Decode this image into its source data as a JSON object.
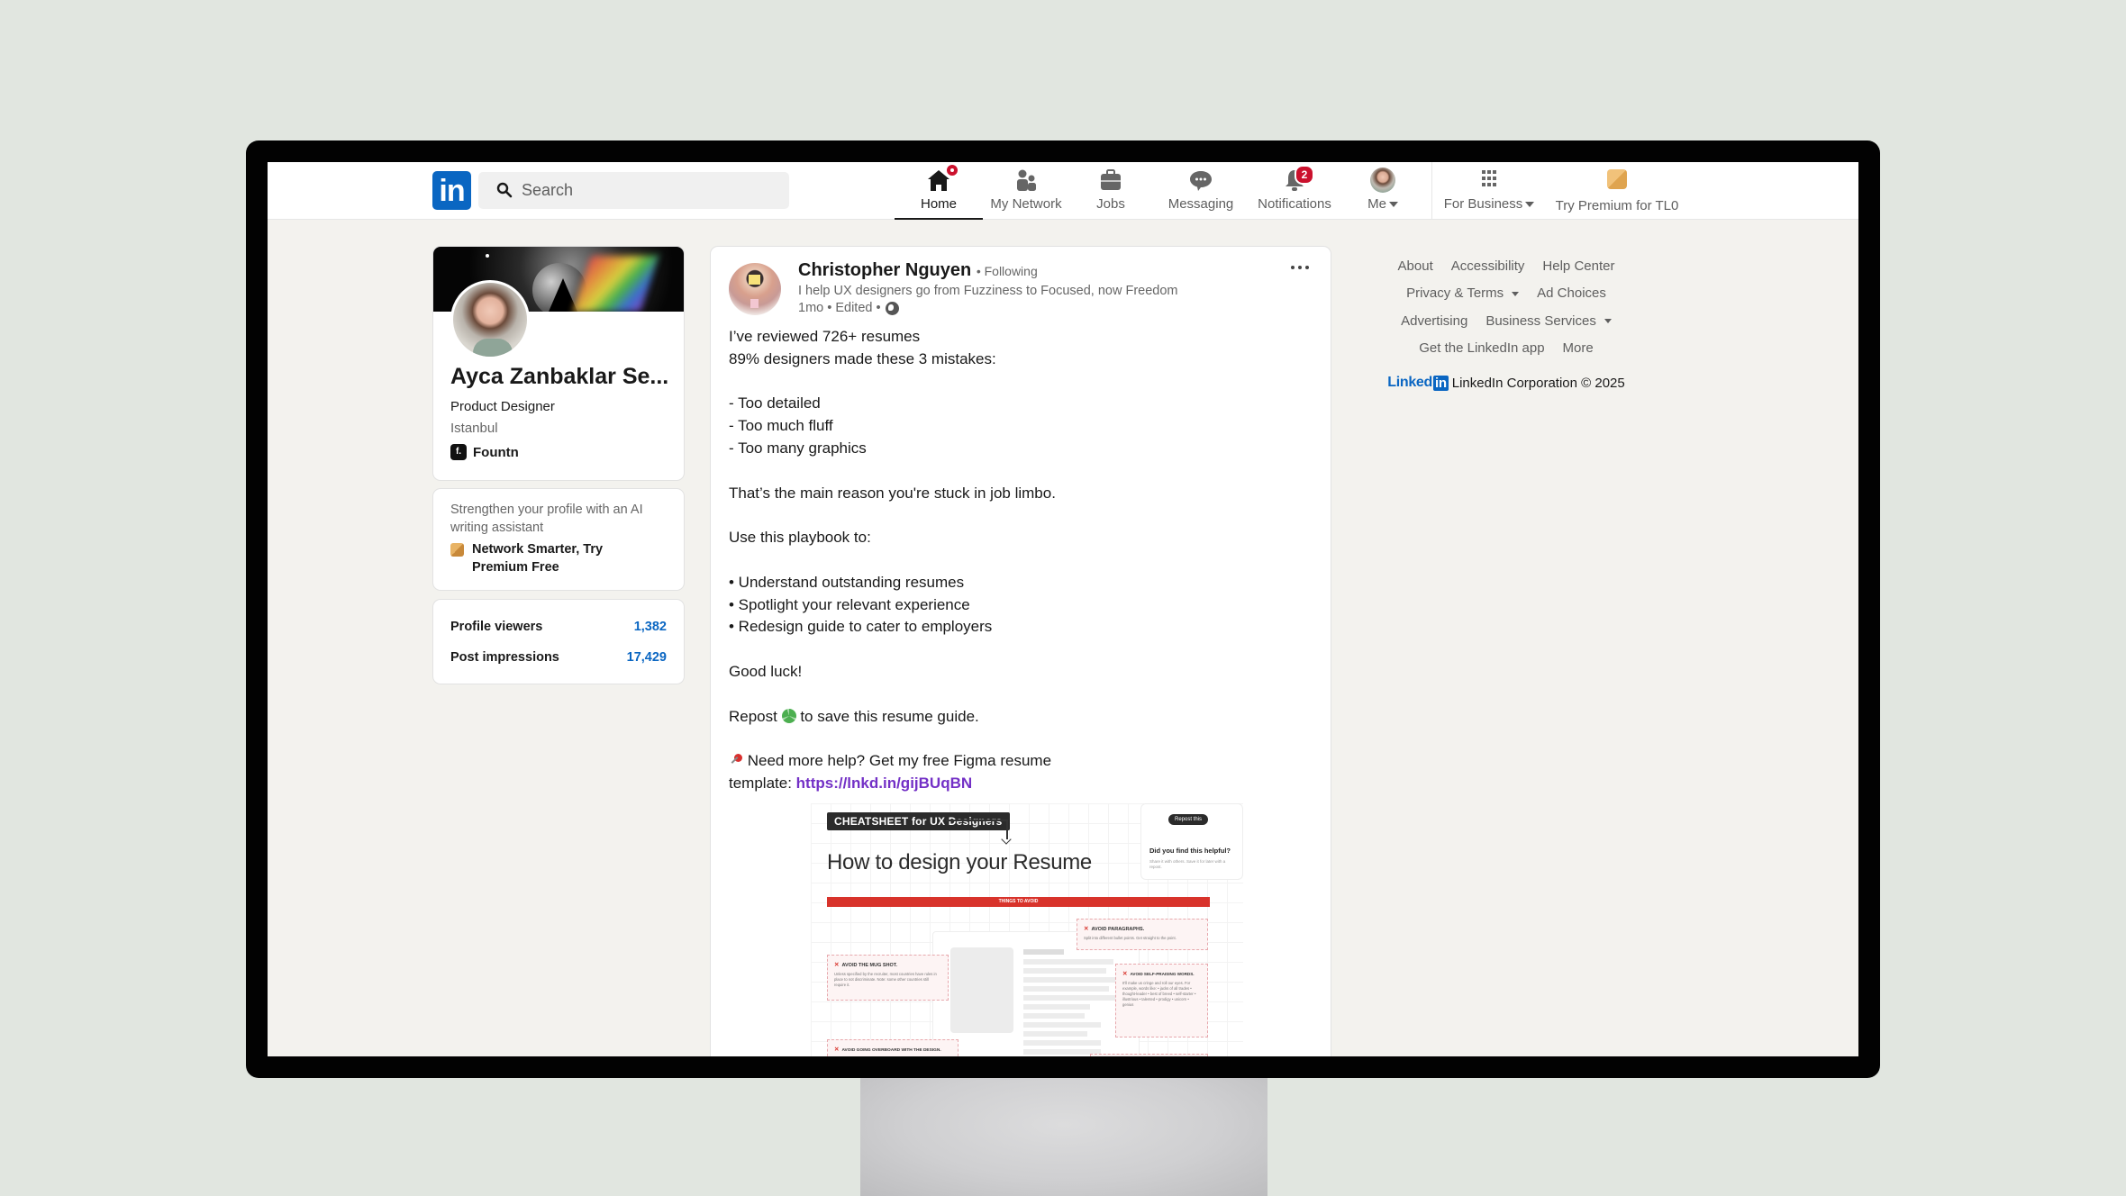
{
  "nav": {
    "logo": "in",
    "search_placeholder": "Search",
    "items": [
      {
        "label": "Home",
        "icon": "home-icon",
        "badge": "dot",
        "active": true
      },
      {
        "label": "My Network",
        "icon": "people-icon"
      },
      {
        "label": "Jobs",
        "icon": "briefcase-icon"
      },
      {
        "label": "Messaging",
        "icon": "chat-bubble-icon"
      },
      {
        "label": "Notifications",
        "icon": "bell-icon",
        "badge": "2"
      },
      {
        "label": "Me",
        "icon": "avatar",
        "dropdown": true
      }
    ],
    "business": {
      "label": "For Business",
      "icon": "grid-icon",
      "dropdown": true
    },
    "premium": {
      "label": "Try Premium for TL0",
      "icon": "premium-icon"
    }
  },
  "profile": {
    "name": "Ayca Zanbaklar Se...",
    "title": "Product Designer",
    "location": "Istanbul",
    "company": "Fountn",
    "company_logo_letter": "f."
  },
  "promo": {
    "text": "Strengthen your profile with an AI writing assistant",
    "link": "Network Smarter, Try Premium Free"
  },
  "stats": [
    {
      "label": "Profile viewers",
      "value": "1,382"
    },
    {
      "label": "Post impressions",
      "value": "17,429"
    }
  ],
  "post": {
    "author": "Christopher Nguyen",
    "follow_status": "• Following",
    "headline": "I help UX designers go from Fuzziness to Focused, now Freedom",
    "time": "1mo • Edited •",
    "lines": [
      "I’ve reviewed 726+ resumes",
      "89% designers made these 3 mistakes:",
      "",
      "- Too detailed",
      "- Too much fluff",
      "- Too many graphics",
      "",
      "That’s the main reason you're stuck in job limbo.",
      "",
      "Use this playbook to:",
      "",
      "• Understand outstanding resumes",
      "• Spotlight your relevant experience",
      "• Redesign guide to cater to employers",
      "",
      "Good luck!",
      ""
    ],
    "repost_before": "Repost ",
    "repost_after": " to save this resume guide.",
    "help_text": " Need more help? Get my free Figma resume",
    "template_label": "template: ",
    "link": "https://lnkd.in/gijBUqBN",
    "image": {
      "tag": "CHEATSHEET for UX Designers",
      "title": "How to design your Resume",
      "repost_btn": "Repost this",
      "question": "Did you find this helpful?",
      "question_sub": "Share it with others. Save it for later with a repost.",
      "section_bar": "THINGS TO AVOID",
      "boxes": [
        {
          "heading": "AVOID PARAGRAPHS.",
          "text": "Split into different bullet points. Get straight to the point."
        },
        {
          "heading": "AVOID THE MUG SHOT.",
          "text": "Unless specified by the recruiter, most countries have rules in place to not discriminate. Note: some other countries still require it."
        },
        {
          "heading": "AVOID SELF-PRAISING WORDS.",
          "text": "It'll make us cringe and roll our eyes. For example, words like: • jacks of all trades • thought-leader • best of breed • self-starter • illustrious • talented • prodigy • unicorn • genius"
        },
        {
          "heading": "AVOID GOING OVERBOARD WITH THE DESIGN.",
          "text": ""
        }
      ]
    }
  },
  "footer": {
    "rows": [
      [
        {
          "label": "About"
        },
        {
          "label": "Accessibility"
        },
        {
          "label": "Help Center"
        }
      ],
      [
        {
          "label": "Privacy & Terms",
          "dropdown": true
        },
        {
          "label": "Ad Choices"
        }
      ],
      [
        {
          "label": "Advertising"
        },
        {
          "label": "Business Services",
          "dropdown": true
        }
      ],
      [
        {
          "label": "Get the LinkedIn app"
        },
        {
          "label": "More"
        }
      ]
    ],
    "brand_word": "Linked",
    "brand_box": "in",
    "copyright": "LinkedIn Corporation © 2025"
  },
  "colors": {
    "brand": "#0a66c2",
    "badge": "#cb112d",
    "link": "#7330c6",
    "page_bg": "#f3f2ee"
  }
}
